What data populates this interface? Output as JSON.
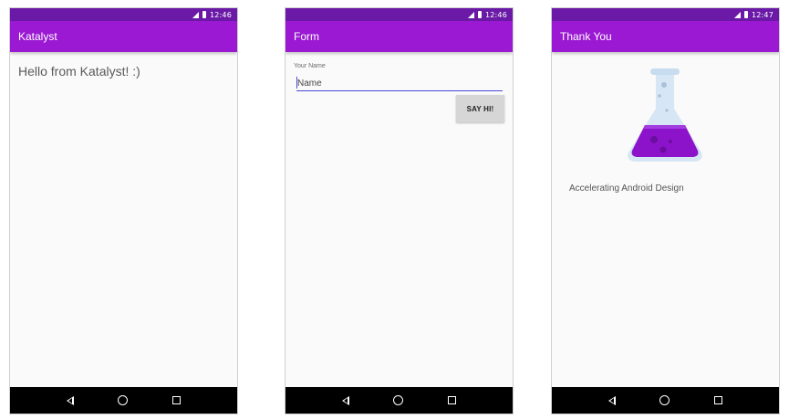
{
  "screens": [
    {
      "status_time": "12:46",
      "title": "Katalyst",
      "content": {
        "greeting": "Hello from Katalyst! :)"
      }
    },
    {
      "status_time": "12:46",
      "title": "Form",
      "content": {
        "field_label": "Your Name",
        "name_placeholder": "Name",
        "name_value": "",
        "button_label": "SAY HI!"
      }
    },
    {
      "status_time": "12:47",
      "title": "Thank You",
      "content": {
        "image": "flask-logo",
        "tagline": "Accelerating Android Design"
      }
    }
  ],
  "icons": {
    "status": [
      "signal-icon",
      "battery-icon"
    ],
    "navigation": [
      "back-icon",
      "home-icon",
      "recents-icon"
    ]
  },
  "colors": {
    "status_bar": "#6a1aa6",
    "app_bar": "#9b19d2",
    "background": "#fafafa",
    "navigation_bar": "#000000",
    "input_underline": "#4a4ad8",
    "button": "#d6d6d6",
    "flask_liquid": "#8c13c9",
    "flask_glass": "#cde1f2"
  }
}
